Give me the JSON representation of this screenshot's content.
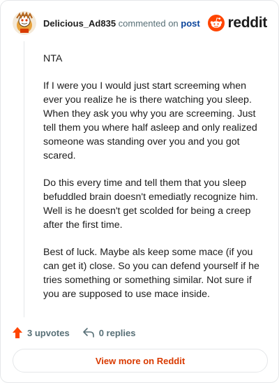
{
  "header": {
    "username": "Delicious_Ad835",
    "commented_text": "commented on",
    "post_link": "post",
    "brand": "reddit",
    "brand_color": "#ff4500",
    "avatar_icon": "snoo-avatar-icon"
  },
  "comment": {
    "paragraphs": [
      "NTA",
      "If I were you I would just start screeming when ever you realize he is there watching you sleep. When they ask you why you are screeming. Just tell them you where half asleep and only realized someone was standing over you and you got scared.",
      "Do this every time and tell them that you sleep befuddled brain doesn't emediatly recognize him. Well is he doesn't get scolded for being a creep after the first time.",
      "Best of luck. Maybe als keep some mace (if you can get it) close. So you can defend yourself if he tries something or something similar. Not sure if you are supposed to use mace inside."
    ]
  },
  "footer": {
    "upvotes": "3 upvotes",
    "replies": "0 replies",
    "upvote_icon": "upvote-arrow-icon",
    "reply_icon": "reply-arrow-icon",
    "upvote_color": "#ff4500"
  },
  "cta": {
    "label": "View more on Reddit",
    "color": "#d93a00"
  }
}
